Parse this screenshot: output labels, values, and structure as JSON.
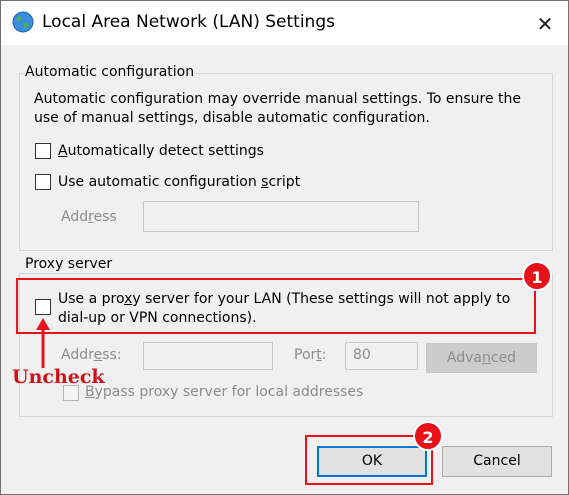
{
  "window": {
    "title": "Local Area Network (LAN) Settings",
    "close_glyph": "✕",
    "icon": "globe-network-icon"
  },
  "auto_config": {
    "group_label": "Automatic configuration",
    "description_line1": "Automatic configuration may override manual settings.  To ensure the",
    "description_line2": "use of manual settings, disable automatic configuration.",
    "detect_checkbox": {
      "label_accel": "A",
      "label_rest": "utomatically detect settings",
      "checked": false
    },
    "script_checkbox": {
      "label_pre": "Use automatic configuration ",
      "label_accel": "s",
      "label_rest": "cript",
      "checked": false
    },
    "address": {
      "label_pre": "Add",
      "label_accel": "r",
      "label_rest": "ess",
      "value": "",
      "enabled": false
    }
  },
  "proxy": {
    "group_label": "Proxy server",
    "use_proxy_checkbox": {
      "line1_pre": "Use a pro",
      "line1_accel": "x",
      "line1_rest": "y server for your LAN (These settings will not apply to",
      "line2": "dial-up or VPN connections).",
      "checked": false
    },
    "address": {
      "label_pre": "Addr",
      "label_accel": "e",
      "label_rest": "ss:",
      "value": "",
      "enabled": false
    },
    "port": {
      "label_pre": "Por",
      "label_accel": "t",
      "label_rest": ":",
      "value": "80",
      "enabled": false
    },
    "advanced_button": {
      "label_pre": "Adva",
      "label_accel": "n",
      "label_rest": "ced",
      "enabled": false
    },
    "bypass_checkbox": {
      "label_accel": "B",
      "label_rest": "ypass proxy server for local addresses",
      "checked": false,
      "enabled": false
    }
  },
  "buttons": {
    "ok": "OK",
    "cancel": "Cancel"
  },
  "annotations": {
    "accent_color": "#e8121b",
    "badge1": "1",
    "badge2": "2",
    "uncheck_text": "Uncheck"
  }
}
